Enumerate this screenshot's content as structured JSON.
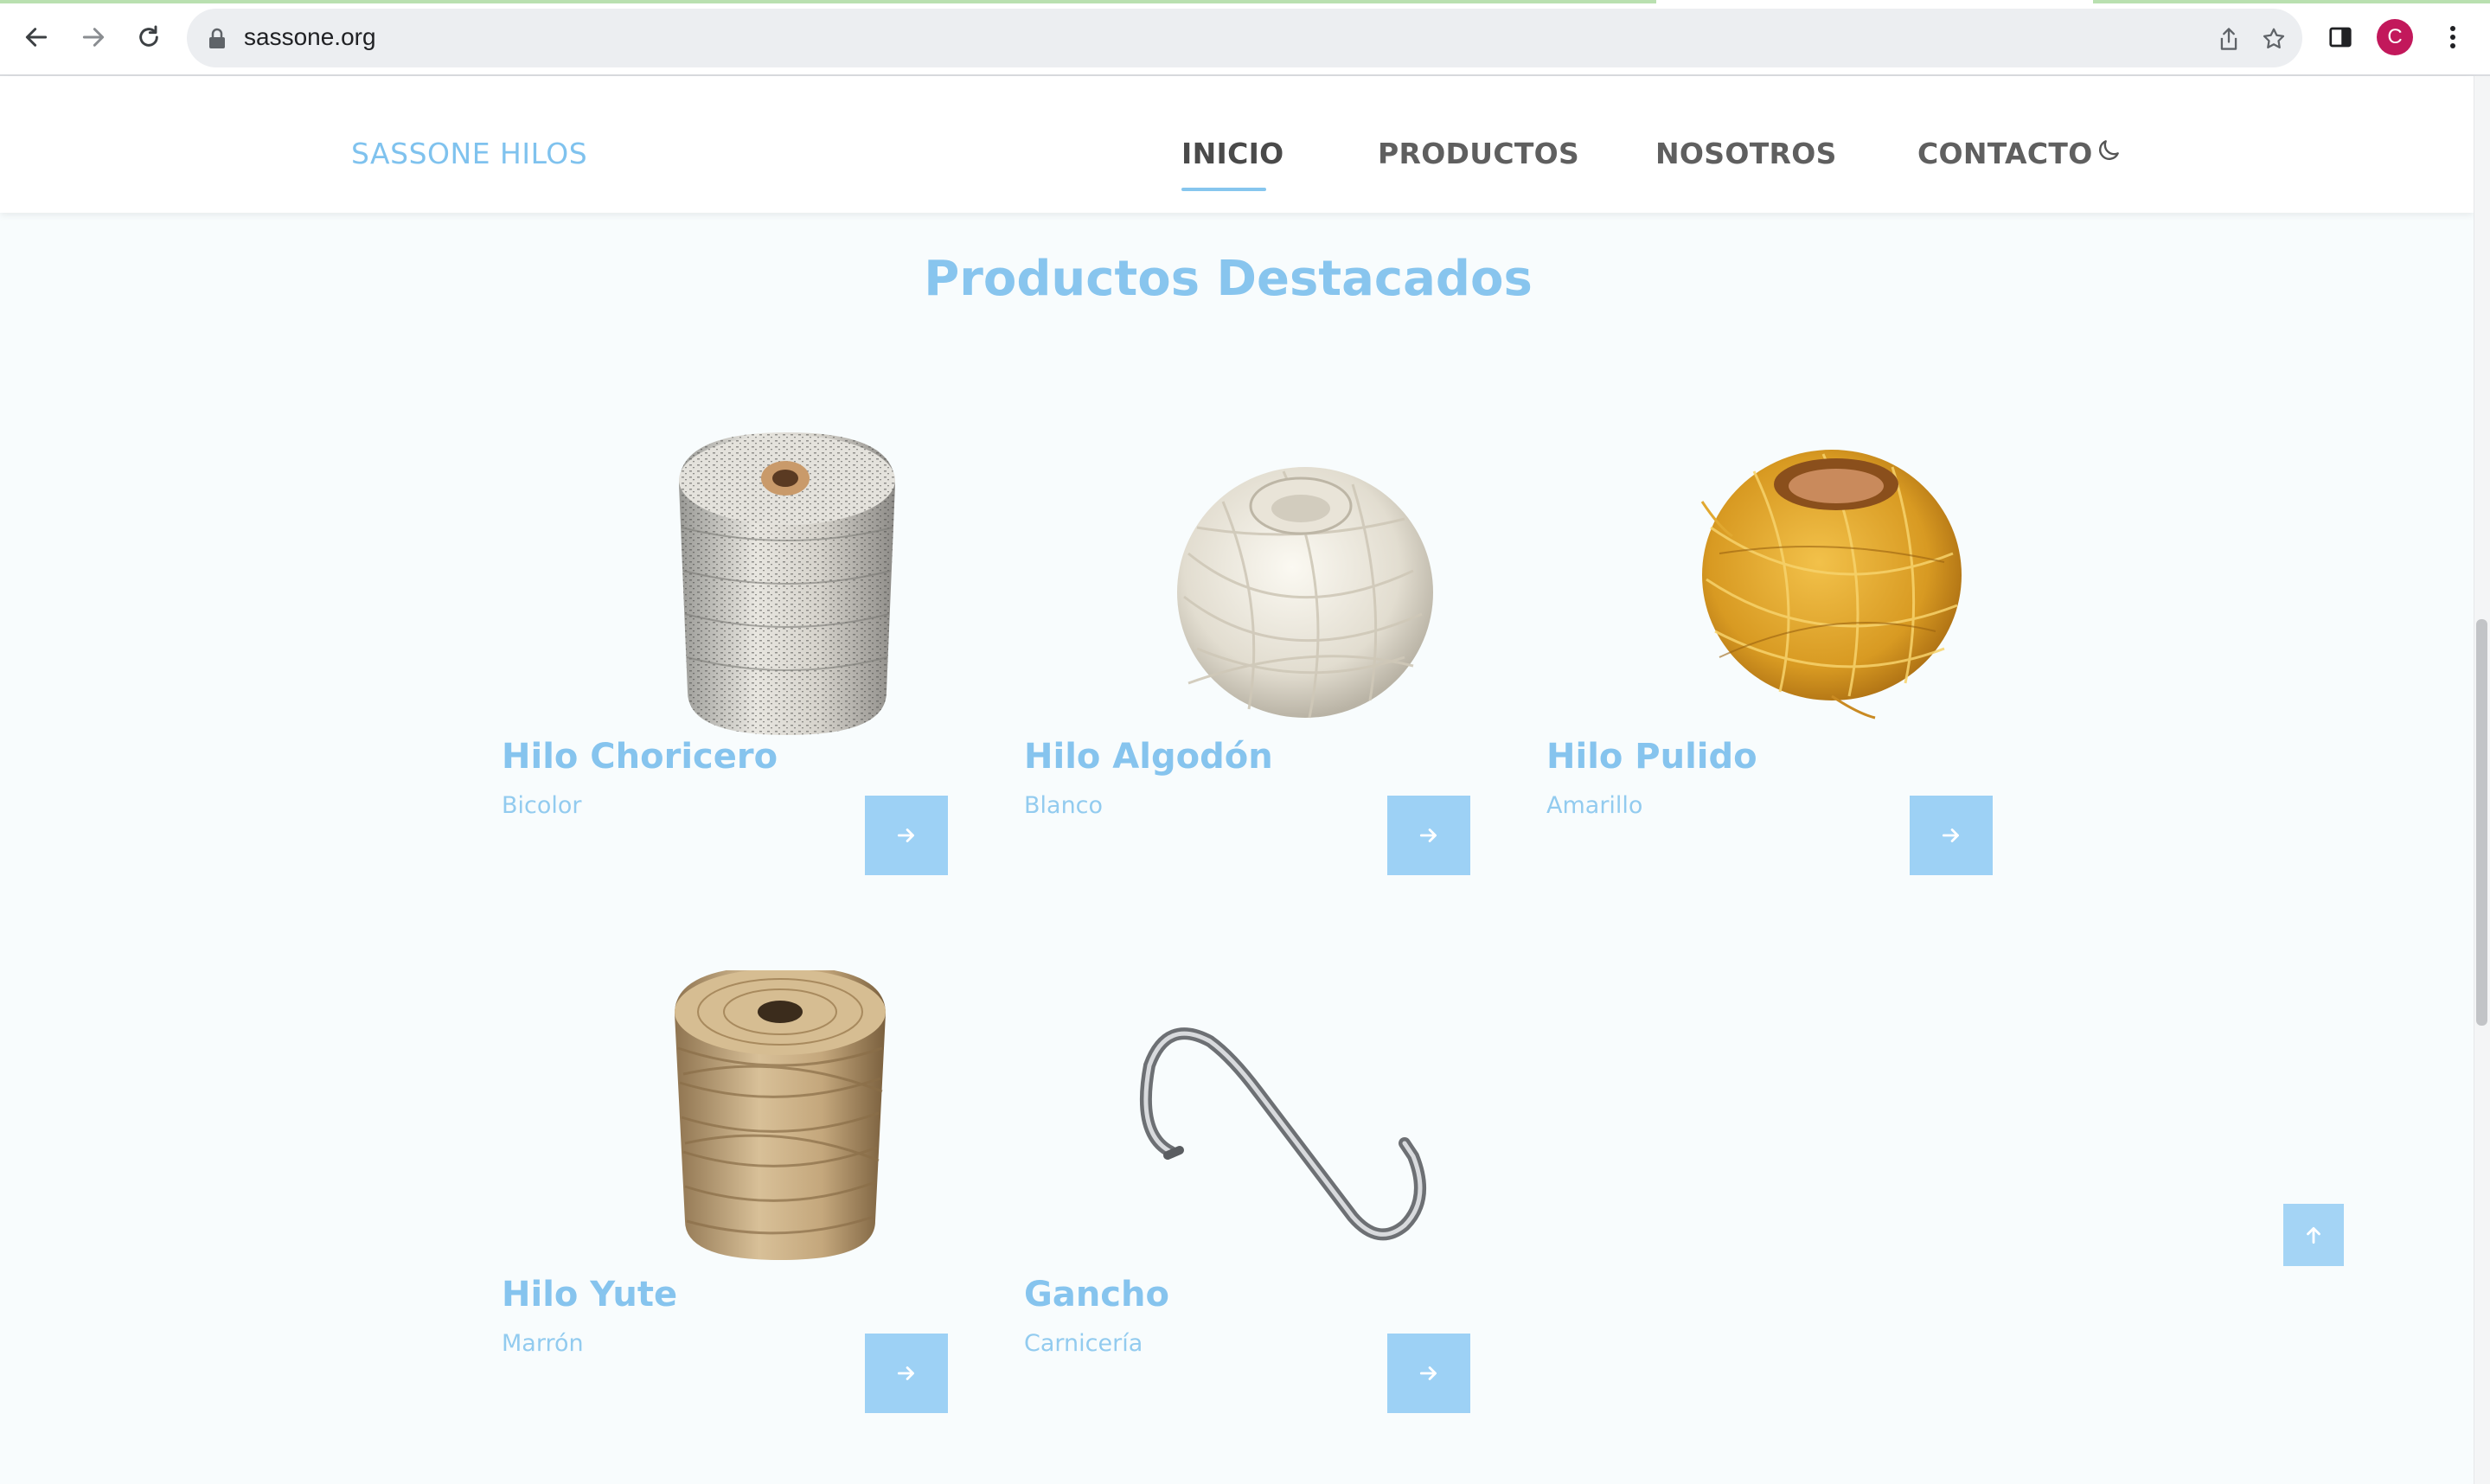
{
  "browser": {
    "url": "sassone.org",
    "avatar_letter": "C",
    "icons": [
      "back-arrow-icon",
      "forward-arrow-icon",
      "reload-icon",
      "lock-icon",
      "share-icon",
      "star-icon",
      "side-panel-icon",
      "kebab-menu-icon"
    ]
  },
  "site": {
    "brand": "SASSONE HILOS",
    "nav": [
      {
        "label": "INICIO",
        "active": true
      },
      {
        "label": "PRODUCTOS",
        "active": false
      },
      {
        "label": "NOSOTROS",
        "active": false
      },
      {
        "label": "CONTACTO",
        "active": false
      }
    ],
    "theme_toggle_icon": "moon-icon"
  },
  "featured": {
    "title": "Productos Destacados",
    "products": [
      {
        "name": "Hilo Choricero",
        "variant": "Bicolor",
        "image": "spool-bicolor"
      },
      {
        "name": "Hilo Algodón",
        "variant": "Blanco",
        "image": "ball-white"
      },
      {
        "name": "Hilo Pulido",
        "variant": "Amarillo",
        "image": "ball-yellow"
      },
      {
        "name": "Hilo Yute",
        "variant": "Marrón",
        "image": "spool-jute"
      },
      {
        "name": "Gancho",
        "variant": "Carnicería",
        "image": "s-hook"
      }
    ]
  },
  "colors": {
    "accent": "#86c4ee",
    "button": "#9dd1f5",
    "background": "#f8fcfd"
  }
}
